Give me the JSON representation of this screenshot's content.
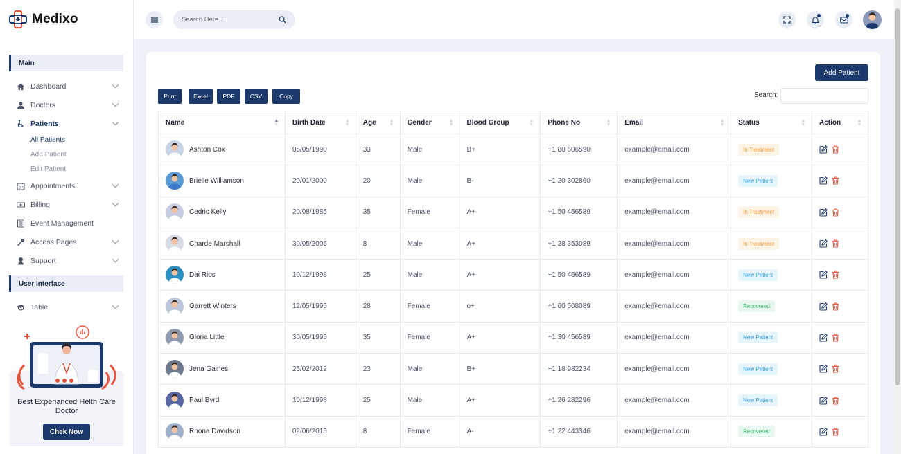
{
  "app": {
    "name": "Medixo"
  },
  "sidebar": {
    "section_main": "Main",
    "section_ui": "User Interface",
    "items": [
      {
        "label": "Dashboard",
        "icon": "home-icon"
      },
      {
        "label": "Doctors",
        "icon": "doctor-icon"
      },
      {
        "label": "Patients",
        "icon": "wheelchair-icon"
      },
      {
        "label": "Appointments",
        "icon": "calendar-icon"
      },
      {
        "label": "Billing",
        "icon": "money-icon"
      },
      {
        "label": "Event Management",
        "icon": "list-icon"
      },
      {
        "label": "Access Pages",
        "icon": "key-icon"
      },
      {
        "label": "Support",
        "icon": "support-icon"
      },
      {
        "label": "Table",
        "icon": "graduation-icon"
      }
    ],
    "patients_sub": [
      "All Patients",
      "Add Patient",
      "Edit Patient"
    ],
    "promo": {
      "text": "Best Experianced Helth Care Doctor",
      "button": "Chek Now"
    }
  },
  "header": {
    "search_placeholder": "Search Here...."
  },
  "toolbar": {
    "add_patient": "Add Patient",
    "exports": [
      "Print",
      "Excel",
      "PDF",
      "CSV",
      "Copy"
    ],
    "search_label": "Search:"
  },
  "table": {
    "columns": [
      "Name",
      "Birth Date",
      "Age",
      "Gender",
      "Blood Group",
      "Phone No",
      "Email",
      "Status",
      "Action"
    ],
    "rows": [
      {
        "name": "Ashton Cox",
        "birth": "05/05/1990",
        "age": "33",
        "gender": "Male",
        "blood": "B+",
        "phone": "+1 80 606590",
        "email": "example@email.com",
        "status": "In Treatment"
      },
      {
        "name": "Brielle Williamson",
        "birth": "20/01/2000",
        "age": "20",
        "gender": "Male",
        "blood": "B-",
        "phone": "+1 20 302860",
        "email": "example@email.com",
        "status": "New Patient"
      },
      {
        "name": "Cedric Kelly",
        "birth": "20/08/1985",
        "age": "35",
        "gender": "Female",
        "blood": "A+",
        "phone": "+1 50 456589",
        "email": "example@email.com",
        "status": "In Treatment"
      },
      {
        "name": "Charde Marshall",
        "birth": "30/05/2005",
        "age": "8",
        "gender": "Male",
        "blood": "A+",
        "phone": "+1 28 353089",
        "email": "example@email.com",
        "status": "In Treatment"
      },
      {
        "name": "Dai Rios",
        "birth": "10/12/1998",
        "age": "25",
        "gender": "Male",
        "blood": "A+",
        "phone": "+1 50 456589",
        "email": "example@email.com",
        "status": "New Patient"
      },
      {
        "name": "Garrett Winters",
        "birth": "12/05/1995",
        "age": "28",
        "gender": "Female",
        "blood": "o+",
        "phone": "+1 60 508089",
        "email": "example@email.com",
        "status": "Recovered"
      },
      {
        "name": "Gloria Little",
        "birth": "30/05/1995",
        "age": "35",
        "gender": "Female",
        "blood": "A+",
        "phone": "+1 30 456589",
        "email": "example@email.com",
        "status": "New Patient"
      },
      {
        "name": "Jena Gaines",
        "birth": "25/02/2012",
        "age": "23",
        "gender": "Male",
        "blood": "B+",
        "phone": "+1 18 982234",
        "email": "example@email.com",
        "status": "New Patient"
      },
      {
        "name": "Paul Byrd",
        "birth": "10/12/1998",
        "age": "25",
        "gender": "Male",
        "blood": "A+",
        "phone": "+1 26 282296",
        "email": "example@email.com",
        "status": "New Patient"
      },
      {
        "name": "Rhona Davidson",
        "birth": "02/06/2015",
        "age": "8",
        "gender": "Female",
        "blood": "A-",
        "phone": "+1 22 443346",
        "email": "example@email.com",
        "status": "Recovered"
      }
    ]
  },
  "colors": {
    "primary": "#1b3a6b",
    "in_treatment_bg": "#fff3e6",
    "in_treatment_fg": "#f5962f",
    "new_patient_bg": "#e6f4fc",
    "new_patient_fg": "#2f9fd8",
    "recovered_bg": "#e7f7ee",
    "recovered_fg": "#2fb36b",
    "edit_icon": "#1b3a6b",
    "delete_icon": "#e8553e"
  }
}
